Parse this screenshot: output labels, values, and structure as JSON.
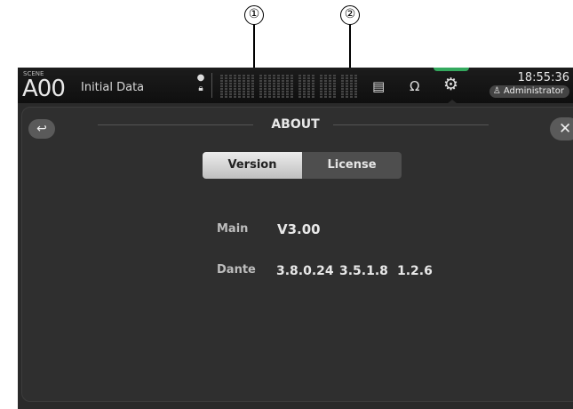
{
  "callouts": {
    "one": "①",
    "two": "②"
  },
  "header": {
    "scene_tag": "SCENE",
    "scene_number": "A00",
    "scene_name": "Initial Data",
    "clock": "18:55:36",
    "user": "Administrator",
    "icons": [
      "recorder-icon",
      "headphones-icon",
      "gear-icon"
    ]
  },
  "about": {
    "title": "ABOUT",
    "tabs": [
      {
        "label": "Version",
        "selected": true
      },
      {
        "label": "License",
        "selected": false
      }
    ],
    "main_label": "Main",
    "main_value": "V3.00",
    "dante_label": "Dante",
    "dante_values": [
      "3.8.0.24",
      "3.5.1.8",
      "1.2.6"
    ]
  },
  "colors": {
    "accent_green": "#38c26a",
    "panel": "#2f2f2f",
    "selected_tab": "#dcdcdc"
  }
}
